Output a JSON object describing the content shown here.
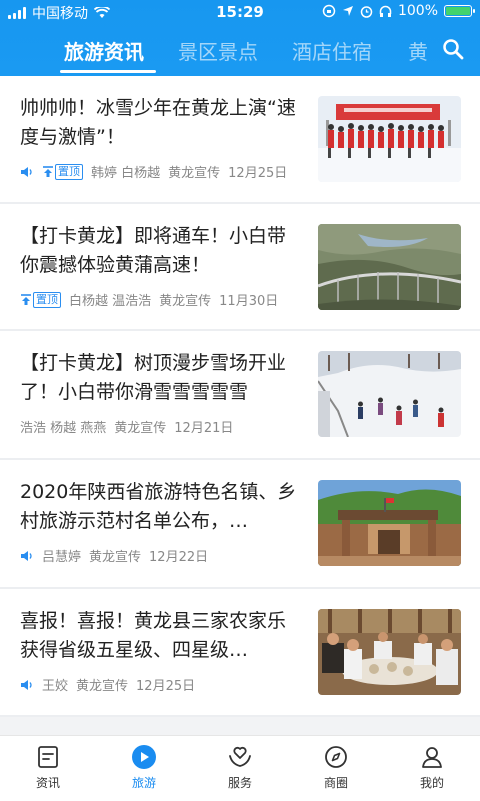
{
  "status_bar": {
    "carrier": "中国移动",
    "time": "15:29",
    "battery": "100%"
  },
  "tabs": [
    {
      "label": "旅游资讯",
      "active": true
    },
    {
      "label": "景区景点",
      "active": false
    },
    {
      "label": "酒店住宿",
      "active": false
    },
    {
      "label": "黄",
      "active": false
    }
  ],
  "articles": [
    {
      "title": "帅帅帅！冰雪少年在黄龙上演“速度与激情”！",
      "audio": true,
      "pinned": true,
      "pinned_label": "置顶",
      "authors": "韩婷 白杨越",
      "source": "黄龙宣传",
      "date": "12月25日",
      "thumb": "snow-race-photo"
    },
    {
      "title": "【打卡黄龙】即将通车！小白带你震撼体验黄蒲高速！",
      "audio": false,
      "pinned": true,
      "pinned_label": "置顶",
      "authors": "白杨越 温浩浩",
      "source": "黄龙宣传",
      "date": "11月30日",
      "thumb": "highway-bridge-photo"
    },
    {
      "title": "【打卡黄龙】树顶漫步雪场开业了！小白带你滑雪雪雪雪雪",
      "audio": false,
      "pinned": false,
      "pinned_label": "",
      "authors": "浩浩 杨越 燕燕",
      "source": "黄龙宣传",
      "date": "12月21日",
      "thumb": "ski-resort-photo"
    },
    {
      "title": "2020年陕西省旅游特色名镇、乡村旅游示范村名单公布，…",
      "audio": true,
      "pinned": false,
      "pinned_label": "",
      "authors": "吕慧婷",
      "source": "黄龙宣传",
      "date": "12月22日",
      "thumb": "village-gate-photo"
    },
    {
      "title": "喜报！喜报！黄龙县三家农家乐获得省级五星级、四星级…",
      "audio": true,
      "pinned": false,
      "pinned_label": "",
      "authors": "王姣",
      "source": "黄龙宣传",
      "date": "12月25日",
      "thumb": "farmhouse-dinner-photo"
    }
  ],
  "bottom_nav": [
    {
      "label": "资讯",
      "icon": "news-icon",
      "active": false
    },
    {
      "label": "旅游",
      "icon": "play-icon",
      "active": true
    },
    {
      "label": "服务",
      "icon": "heart-hands-icon",
      "active": false
    },
    {
      "label": "商圈",
      "icon": "compass-icon",
      "active": false
    },
    {
      "label": "我的",
      "icon": "person-icon",
      "active": false
    }
  ],
  "colors": {
    "header": "#1a9af2",
    "accent": "#1a8cf0",
    "battery": "#42d36d"
  }
}
